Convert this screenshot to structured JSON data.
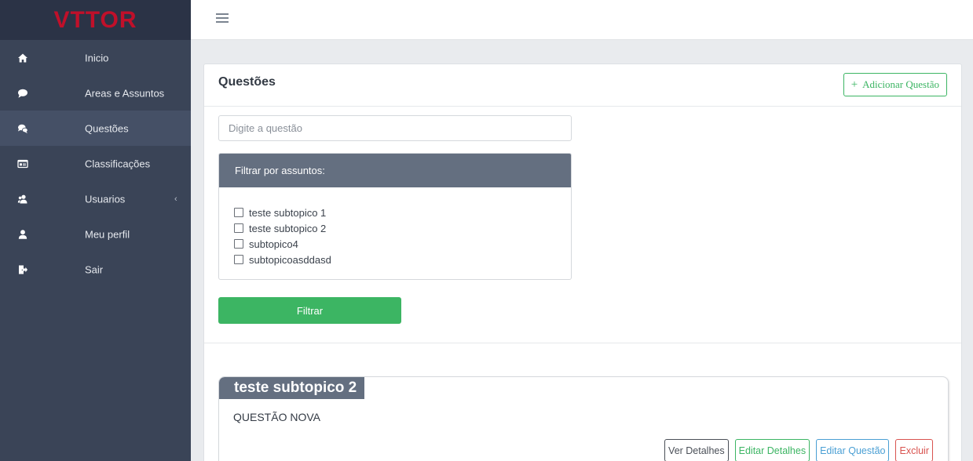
{
  "brand": {
    "logo_text": "VTTOR",
    "logo_color": "#c0102a"
  },
  "sidebar": {
    "items": [
      {
        "label": "Inicio",
        "icon": "home-icon"
      },
      {
        "label": "Areas e Assuntos",
        "icon": "speech-bubble-icon"
      },
      {
        "label": "Questões",
        "icon": "chat-bubbles-icon",
        "active": true
      },
      {
        "label": "Classificações",
        "icon": "card-list-icon"
      },
      {
        "label": "Usuarios",
        "icon": "users-icon",
        "chevron": "‹"
      },
      {
        "label": "Meu perfil",
        "icon": "user-icon"
      },
      {
        "label": "Sair",
        "icon": "sign-out-icon"
      }
    ]
  },
  "topbar": {
    "menu_icon": "hamburger-icon"
  },
  "main": {
    "title": "Questões",
    "add_button": {
      "icon": "+",
      "label": "Adicionar Questão"
    },
    "search": {
      "placeholder": "Digite a questão",
      "value": ""
    },
    "filter": {
      "heading": "Filtrar por assuntos:",
      "options": [
        {
          "label": "teste subtopico 1",
          "checked": false
        },
        {
          "label": "teste subtopico 2",
          "checked": false
        },
        {
          "label": "subtopico4",
          "checked": false
        },
        {
          "label": "subtopicoasddasd",
          "checked": false
        }
      ],
      "button_label": "Filtrar"
    },
    "question": {
      "tag": "teste subtopico 2",
      "text": "QUESTÃO NOVA",
      "actions": {
        "details": "Ver Detalhes",
        "edit_details": "Editar Detalhes",
        "edit_question": "Editar Questão",
        "delete": "Excluir"
      }
    }
  },
  "colors": {
    "sidebar_bg": "#3a4457",
    "accent_green": "#3cb563",
    "header_gray": "#646f80",
    "danger": "#d9534f",
    "info": "#4a9fd4"
  }
}
